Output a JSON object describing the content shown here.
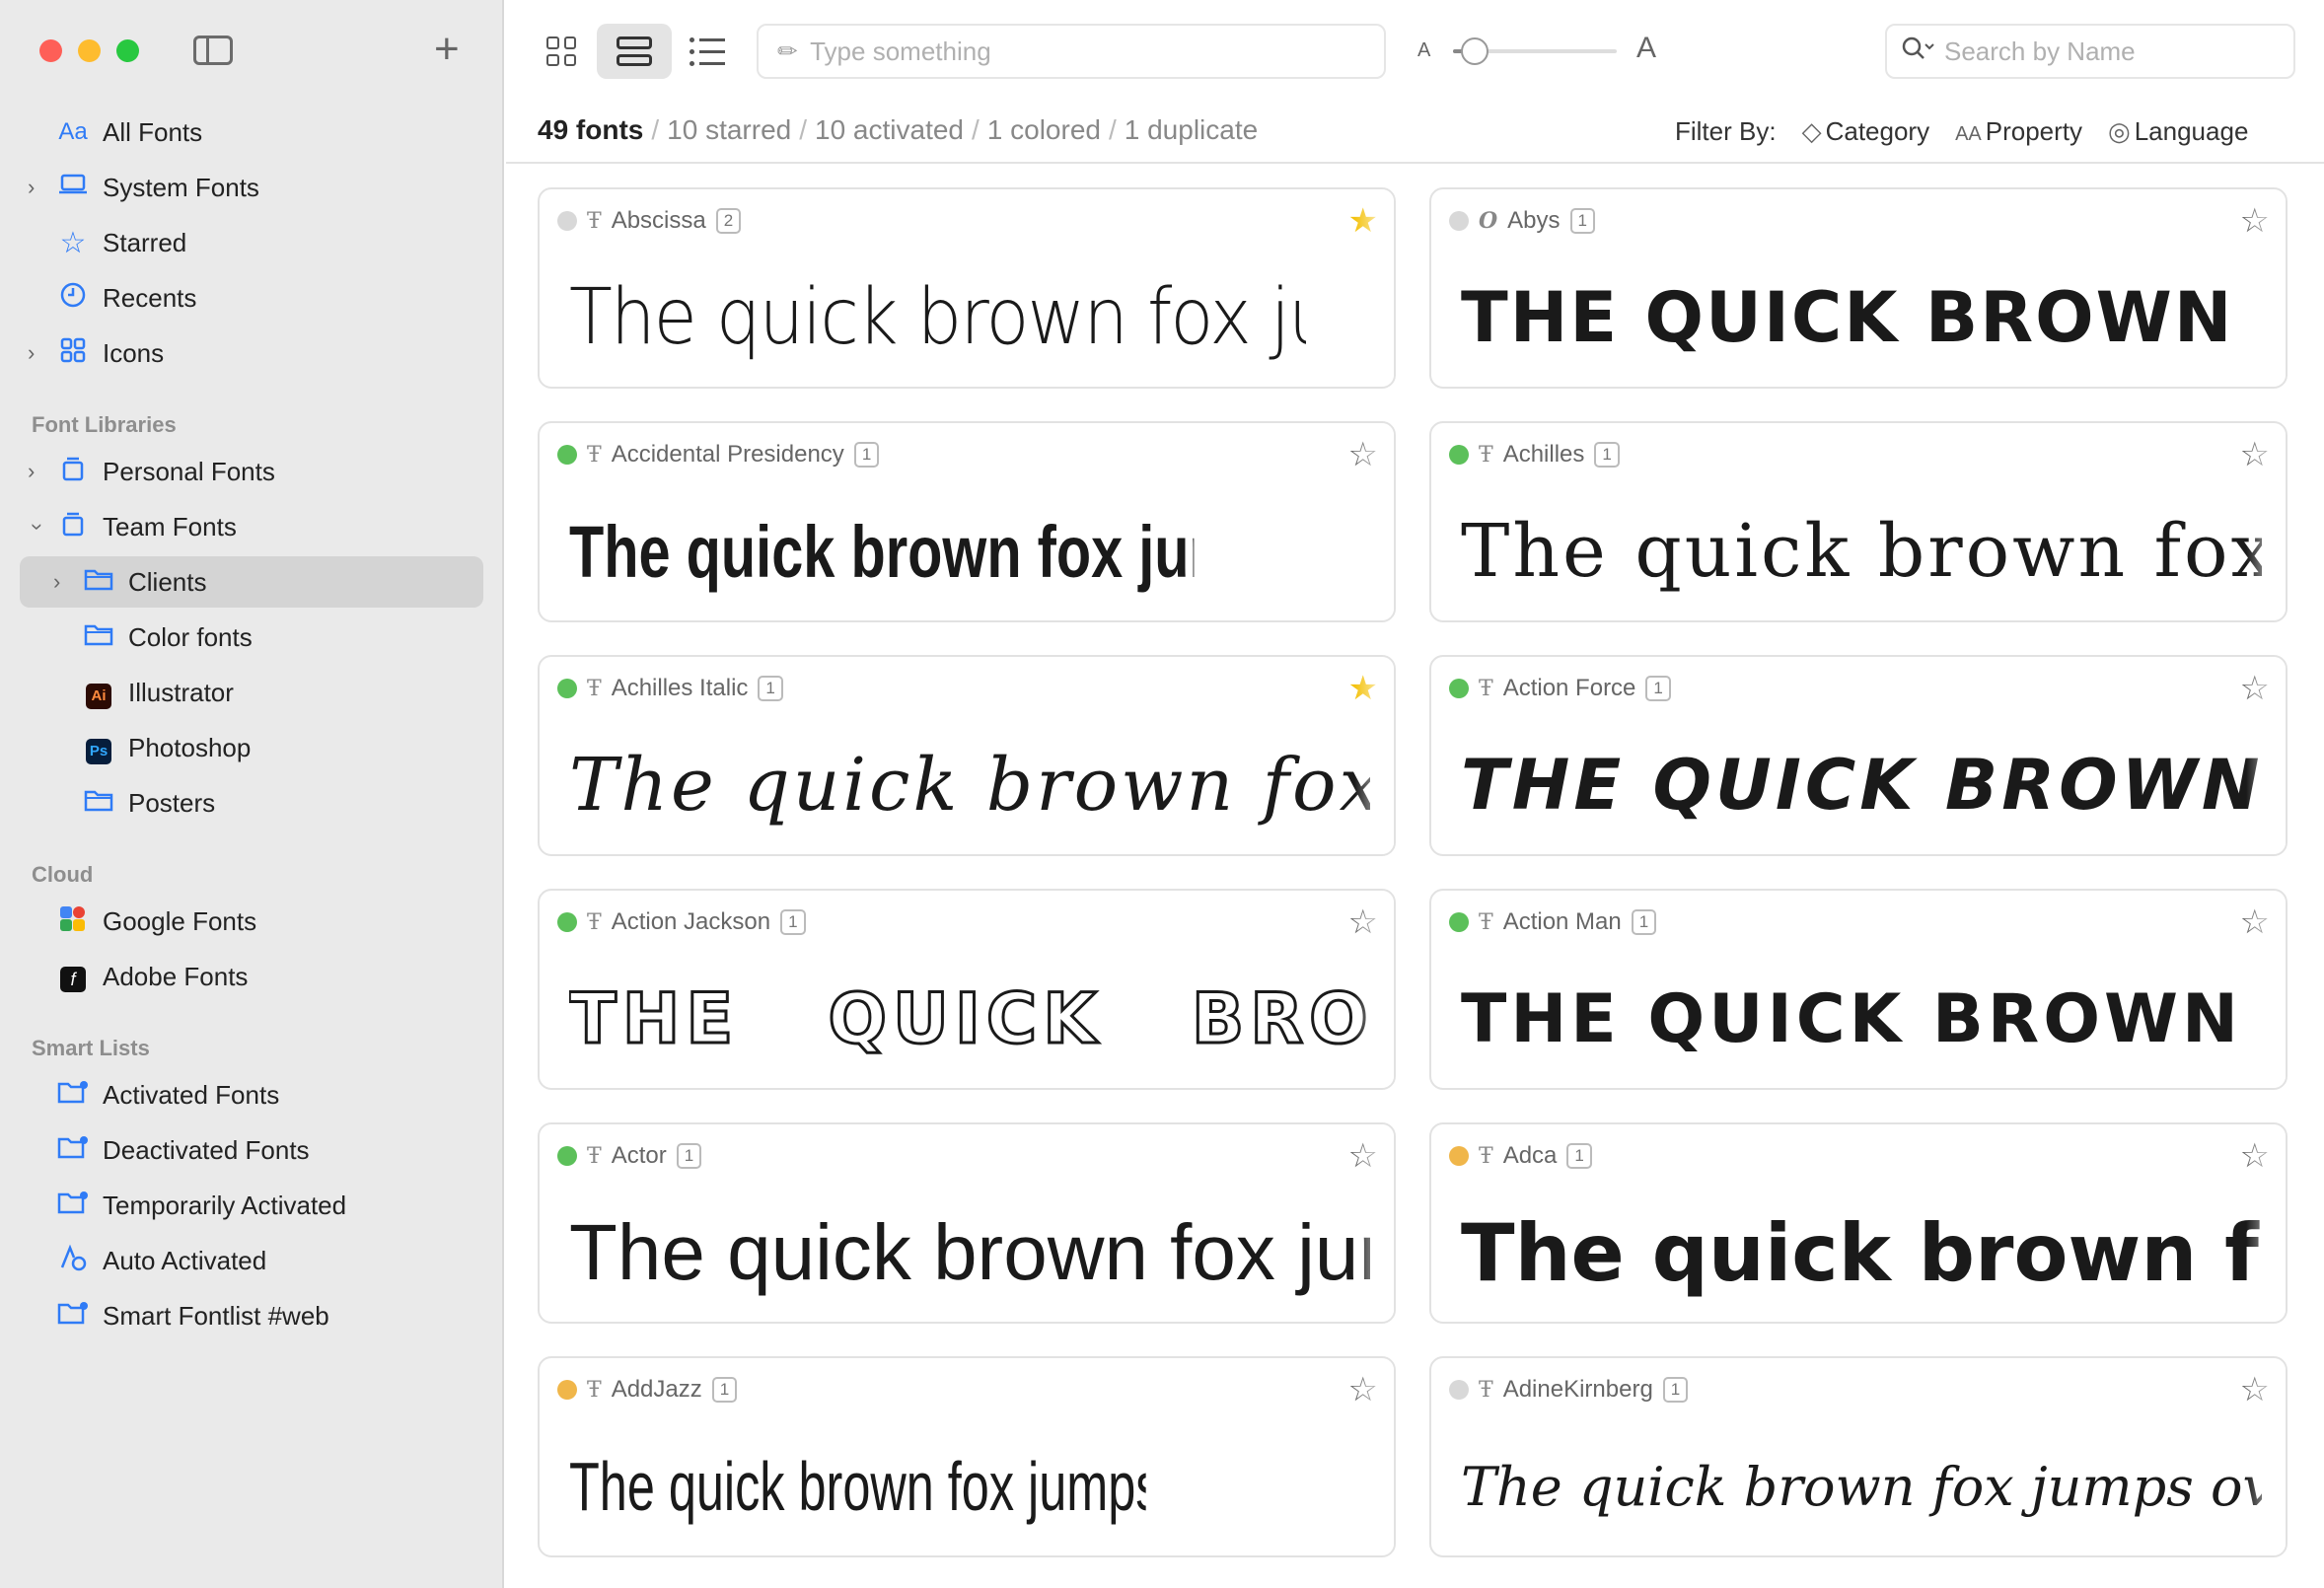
{
  "colors": {
    "accent": "#2f7bf6",
    "close": "#fe5f57",
    "minimize": "#febc2e",
    "zoom": "#28c840",
    "status_green": "#5cc05a",
    "status_gray": "#d8d8d8",
    "status_yellow": "#f0b64a",
    "star_on": "#f4c20d"
  },
  "sidebar": {
    "add_label": "+",
    "items": [
      {
        "label": "All Fonts",
        "icon": "aa-icon"
      },
      {
        "label": "System Fonts",
        "icon": "laptop-icon"
      },
      {
        "label": "Starred",
        "icon": "star-icon"
      },
      {
        "label": "Recents",
        "icon": "clock-icon"
      },
      {
        "label": "Icons",
        "icon": "grid-icon"
      }
    ],
    "libraries_title": "Font Libraries",
    "libraries": [
      {
        "label": "Personal Fonts",
        "icon": "library-icon"
      },
      {
        "label": "Team Fonts",
        "icon": "library-icon"
      },
      {
        "label": "Clients",
        "icon": "folder-icon"
      },
      {
        "label": "Color fonts",
        "icon": "folder-icon"
      },
      {
        "label": "Illustrator",
        "icon": "illustrator-icon",
        "badge": "Ai"
      },
      {
        "label": "Photoshop",
        "icon": "photoshop-icon",
        "badge": "Ps"
      },
      {
        "label": "Posters",
        "icon": "folder-icon"
      }
    ],
    "cloud_title": "Cloud",
    "cloud": [
      {
        "label": "Google Fonts",
        "icon": "google-fonts-icon"
      },
      {
        "label": "Adobe Fonts",
        "icon": "adobe-fonts-icon",
        "badge": "f"
      }
    ],
    "smart_title": "Smart Lists",
    "smart": [
      {
        "label": "Activated Fonts",
        "icon": "smart-folder-icon"
      },
      {
        "label": "Deactivated Fonts",
        "icon": "smart-folder-icon"
      },
      {
        "label": "Temporarily Activated",
        "icon": "smart-folder-icon"
      },
      {
        "label": "Auto Activated",
        "icon": "auto-activate-icon"
      },
      {
        "label": "Smart Fontlist #web",
        "icon": "smart-folder-icon"
      }
    ]
  },
  "toolbar": {
    "type_placeholder": "Type something",
    "size_small": "A",
    "size_big": "A",
    "size_level": 0.13,
    "search_placeholder": "Search by Name"
  },
  "summary": {
    "total": "49 fonts",
    "starred": "10 starred",
    "activated": "10 activated",
    "colored": "1 colored",
    "duplicate": "1 duplicate"
  },
  "filter": {
    "label": "Filter By:",
    "category": "Category",
    "property": "Property",
    "language": "Language"
  },
  "fonts": [
    {
      "name": "Abscissa",
      "count": "2",
      "status": "gray",
      "starred": true,
      "sample": "The quick brown fox jumps over the lazy dog"
    },
    {
      "name": "Abys",
      "count": "1",
      "status": "gray",
      "starred": false,
      "sample": "THE QUICK BROWN FOX JUMPS"
    },
    {
      "name": "Accidental Presidency",
      "count": "1",
      "status": "green",
      "starred": false,
      "sample": "The quick brown fox jumps over the lazy dog"
    },
    {
      "name": "Achilles",
      "count": "1",
      "status": "green",
      "starred": false,
      "sample": "The quick brown fox jumps"
    },
    {
      "name": "Achilles Italic",
      "count": "1",
      "status": "green",
      "starred": true,
      "sample": "The quick brown fox jumps"
    },
    {
      "name": "Action Force",
      "count": "1",
      "status": "green",
      "starred": false,
      "sample": "THE QUICK BROWN FOX JUMPS"
    },
    {
      "name": "Action Jackson",
      "count": "1",
      "status": "green",
      "starred": false,
      "sample": "THE QUICK BROWN FOX"
    },
    {
      "name": "Action Man",
      "count": "1",
      "status": "green",
      "starred": false,
      "sample": "THE QUICK BROWN FOX JUMPS"
    },
    {
      "name": "Actor",
      "count": "1",
      "status": "green",
      "starred": false,
      "sample": "The quick brown fox jumps over the lazy dog"
    },
    {
      "name": "Adca",
      "count": "1",
      "status": "yellow",
      "starred": false,
      "sample": "The quick brown fox jumps"
    },
    {
      "name": "AddJazz",
      "count": "1",
      "status": "yellow",
      "starred": false,
      "sample": "The quick brown fox jumps over the lazy dog"
    },
    {
      "name": "AdineKirnberg",
      "count": "1",
      "status": "gray",
      "starred": false,
      "sample": "The quick brown fox jumps over the lazy dog"
    }
  ]
}
